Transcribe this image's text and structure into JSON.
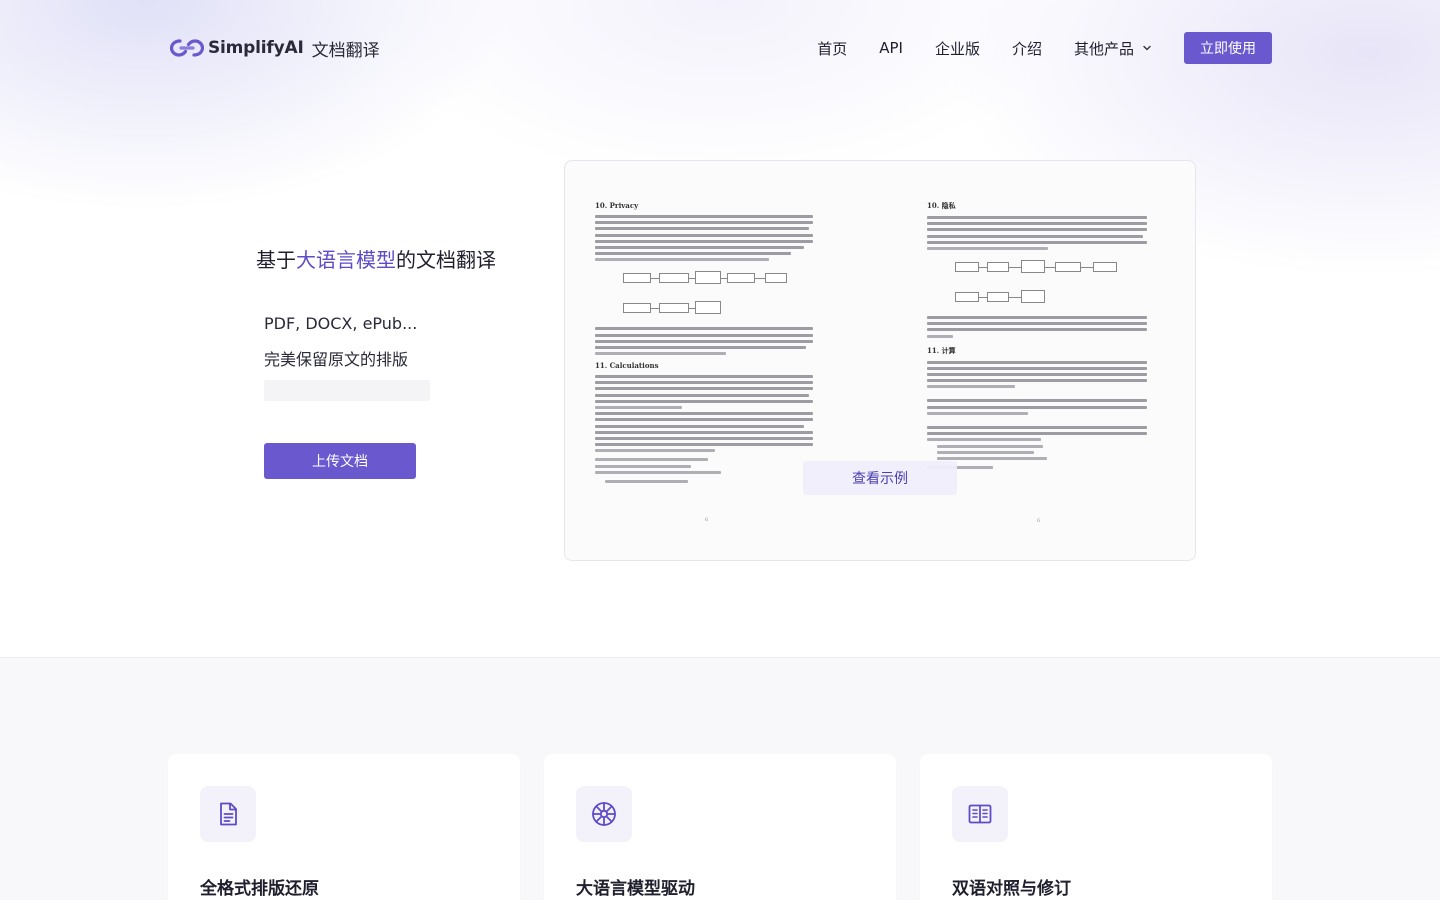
{
  "header": {
    "brand_name": "SimplifyAI",
    "brand_product": "文档翻译",
    "nav": [
      {
        "label": "首页"
      },
      {
        "label": "API"
      },
      {
        "label": "企业版"
      },
      {
        "label": "介绍"
      },
      {
        "label": "其他产品"
      }
    ],
    "cta_label": "立即使用"
  },
  "hero": {
    "title_prefix": "基于",
    "title_accent": "大语言模型",
    "title_suffix": "的文档翻译",
    "formats": "PDF, DOCX, ePub...",
    "layout_note": "完美保留原文的排版",
    "upload_label": "上传文档"
  },
  "preview": {
    "left_heading": "10.  Privacy",
    "left_heading_2": "11.  Calculations",
    "right_heading": "10. 隐私",
    "right_heading_2": "11. 计算",
    "example_label": "查看示例"
  },
  "features": [
    {
      "title": "全格式排版还原",
      "icon": "document-icon"
    },
    {
      "title": "大语言模型驱动",
      "icon": "aperture-icon"
    },
    {
      "title": "双语对照与修订",
      "icon": "book-open-icon"
    }
  ],
  "colors": {
    "accent": "#6a58cf",
    "accent_text": "#5d4bc7",
    "icon_bg": "#f3f2fb"
  }
}
